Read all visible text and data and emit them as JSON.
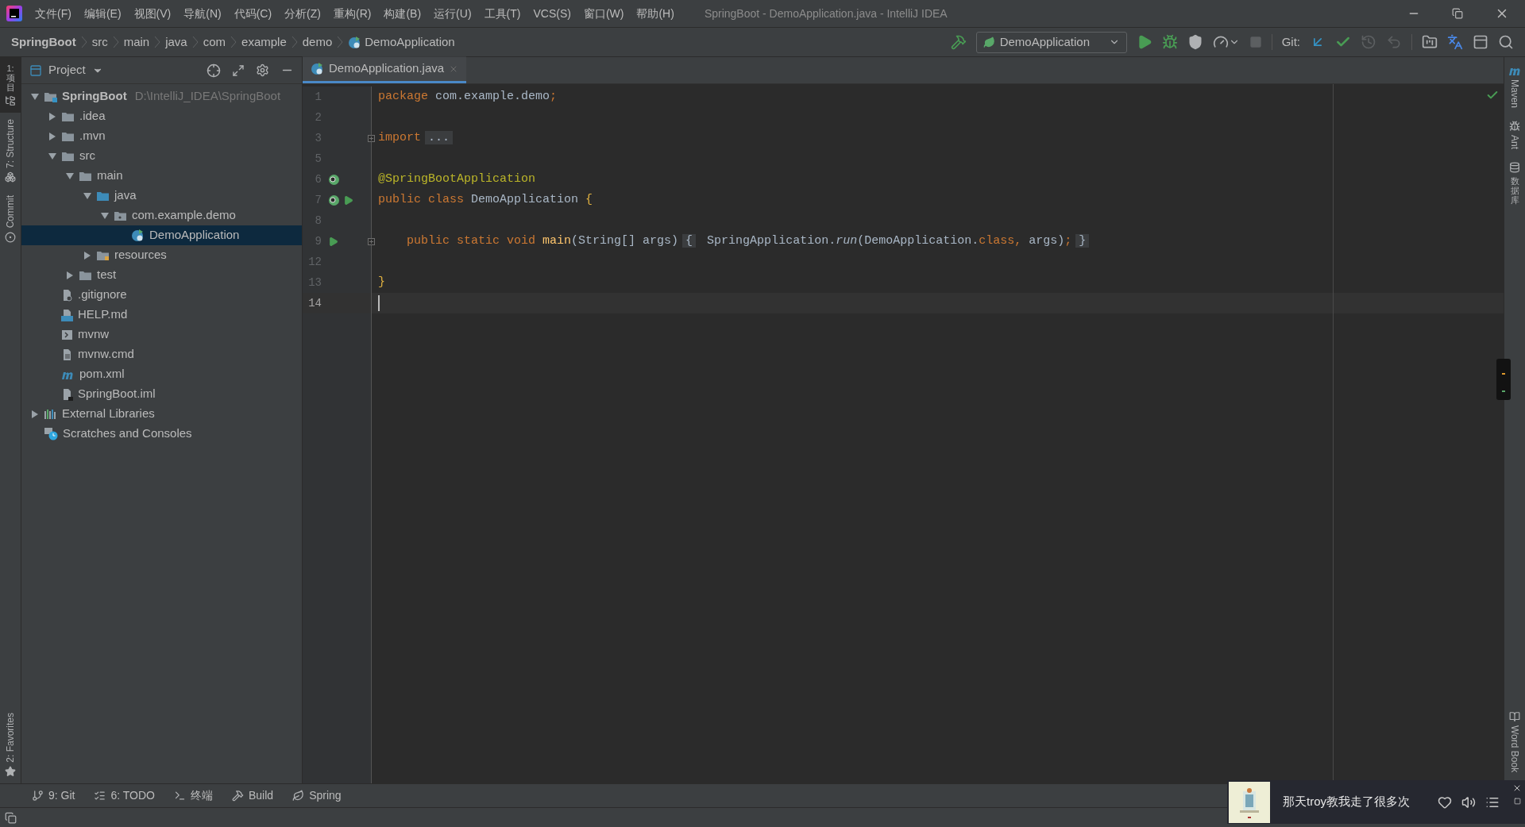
{
  "window": {
    "title": "SpringBoot - DemoApplication.java - IntelliJ IDEA",
    "menu": [
      "文件(F)",
      "编辑(E)",
      "视图(V)",
      "导航(N)",
      "代码(C)",
      "分析(Z)",
      "重构(R)",
      "构建(B)",
      "运行(U)",
      "工具(T)",
      "VCS(S)",
      "窗口(W)",
      "帮助(H)"
    ]
  },
  "breadcrumbs": [
    {
      "label": "SpringBoot",
      "kind": "root"
    },
    {
      "label": "src",
      "kind": "dir"
    },
    {
      "label": "main",
      "kind": "dir"
    },
    {
      "label": "java",
      "kind": "dir"
    },
    {
      "label": "com",
      "kind": "dir"
    },
    {
      "label": "example",
      "kind": "dir"
    },
    {
      "label": "demo",
      "kind": "dir"
    },
    {
      "label": "DemoApplication",
      "kind": "class"
    }
  ],
  "toolbar": {
    "run_config": "DemoApplication",
    "git_label": "Git:",
    "actions": [
      {
        "kind": "run",
        "disabled": false
      },
      {
        "kind": "debug",
        "disabled": false
      },
      {
        "kind": "coverage",
        "disabled": false
      },
      {
        "kind": "profile",
        "disabled": false
      },
      {
        "kind": "stop",
        "disabled": true
      }
    ],
    "git_actions": [
      {
        "kind": "update",
        "disabled": false
      },
      {
        "kind": "commit",
        "disabled": false
      },
      {
        "kind": "history",
        "disabled": true
      },
      {
        "kind": "rollback",
        "disabled": true
      }
    ]
  },
  "left_tool_windows": [
    {
      "label": "1: 项目",
      "kind": "project",
      "selected": true
    },
    {
      "label": "7: Structure",
      "kind": "structure",
      "selected": false
    },
    {
      "label": "Commit",
      "kind": "commit",
      "selected": false
    },
    {
      "label": "2: Favorites",
      "kind": "favorites",
      "selected": false
    }
  ],
  "project_panel": {
    "title": "Project",
    "tree": [
      {
        "label": "SpringBoot",
        "hint": "D:\\IntelliJ_IDEA\\SpringBoot",
        "kind": "module",
        "expanded": true,
        "selected": false,
        "children": [
          {
            "label": ".idea",
            "kind": "folder",
            "expanded": false,
            "selected": false
          },
          {
            "label": ".mvn",
            "kind": "folder",
            "expanded": false,
            "selected": false
          },
          {
            "label": "src",
            "kind": "folder",
            "expanded": true,
            "selected": false,
            "children": [
              {
                "label": "main",
                "kind": "folder",
                "expanded": true,
                "selected": false,
                "children": [
                  {
                    "label": "java",
                    "kind": "source",
                    "expanded": true,
                    "selected": false,
                    "children": [
                      {
                        "label": "com.example.demo",
                        "kind": "package",
                        "expanded": true,
                        "selected": false,
                        "children": [
                          {
                            "label": "DemoApplication",
                            "kind": "spring-class",
                            "selected": true
                          }
                        ]
                      }
                    ]
                  },
                  {
                    "label": "resources",
                    "kind": "resources",
                    "expanded": false,
                    "selected": false
                  }
                ]
              },
              {
                "label": "test",
                "kind": "folder",
                "expanded": false,
                "selected": false
              }
            ]
          },
          {
            "label": ".gitignore",
            "kind": "ignore",
            "selected": false
          },
          {
            "label": "HELP.md",
            "kind": "markdown",
            "selected": false
          },
          {
            "label": "mvnw",
            "kind": "shell",
            "selected": false
          },
          {
            "label": "mvnw.cmd",
            "kind": "text",
            "selected": false
          },
          {
            "label": "pom.xml",
            "kind": "maven",
            "selected": false
          },
          {
            "label": "SpringBoot.iml",
            "kind": "iml",
            "selected": false
          }
        ]
      },
      {
        "label": "External Libraries",
        "kind": "libraries",
        "expanded": false,
        "selected": false
      },
      {
        "label": "Scratches and Consoles",
        "kind": "scratches",
        "selected": false
      }
    ]
  },
  "editor": {
    "tabs": [
      {
        "label": "DemoApplication.java",
        "selected": true
      }
    ],
    "lines": [
      {
        "number": "1",
        "tokens": [
          {
            "text": "package",
            "kind": "keyword"
          },
          {
            "text": " com.example.demo",
            "kind": "plain"
          },
          {
            "text": ";",
            "kind": "keyword"
          }
        ]
      },
      {
        "number": "2"
      },
      {
        "number": "3",
        "fold": true,
        "tokens": [
          {
            "text": "import",
            "kind": "keyword"
          },
          {
            "text": "...",
            "kind": "folded"
          }
        ]
      },
      {
        "number": "5"
      },
      {
        "number": "6",
        "markers": [
          {
            "kind": "bean"
          }
        ],
        "tokens": [
          {
            "text": "@SpringBootApplication",
            "kind": "annotation"
          }
        ]
      },
      {
        "number": "7",
        "markers": [
          {
            "kind": "bean"
          },
          {
            "kind": "run"
          }
        ],
        "tokens": [
          {
            "text": "public class ",
            "kind": "keyword"
          },
          {
            "text": "DemoApplication ",
            "kind": "plain"
          },
          {
            "text": "{",
            "kind": "brace"
          }
        ]
      },
      {
        "number": "8"
      },
      {
        "number": "9",
        "markers": [
          {
            "kind": "run"
          }
        ],
        "fold": true,
        "tokens": [
          {
            "text": "    public static void ",
            "kind": "keyword"
          },
          {
            "text": "main",
            "kind": "method"
          },
          {
            "text": "(String[] args)",
            "kind": "plain"
          },
          {
            "text": "{",
            "kind": "folded"
          },
          {
            "text": " SpringApplication.",
            "kind": "plain"
          },
          {
            "text": "run",
            "kind": "static-call"
          },
          {
            "text": "(DemoApplication.",
            "kind": "plain"
          },
          {
            "text": "class, ",
            "kind": "keyword"
          },
          {
            "text": "args)",
            "kind": "plain"
          },
          {
            "text": ";",
            "kind": "keyword"
          },
          {
            "text": "}",
            "kind": "folded"
          }
        ]
      },
      {
        "number": "12"
      },
      {
        "number": "13",
        "tokens": [
          {
            "text": "}",
            "kind": "brace"
          }
        ]
      },
      {
        "number": "14",
        "current": true
      }
    ]
  },
  "right_tool_windows": [
    {
      "label": "Maven",
      "kind": "maven"
    },
    {
      "label": "Ant",
      "kind": "ant"
    },
    {
      "label": "数据库",
      "kind": "database"
    },
    {
      "label": "Word Book",
      "kind": "book"
    }
  ],
  "bottom_tools": [
    {
      "label": "9: Git",
      "kind": "git"
    },
    {
      "label": "6: TODO",
      "kind": "todo"
    },
    {
      "label": "终端",
      "kind": "terminal"
    },
    {
      "label": "Build",
      "kind": "build"
    },
    {
      "label": "Spring",
      "kind": "spring"
    }
  ],
  "music": {
    "song": "那天troy教我走了很多次"
  }
}
